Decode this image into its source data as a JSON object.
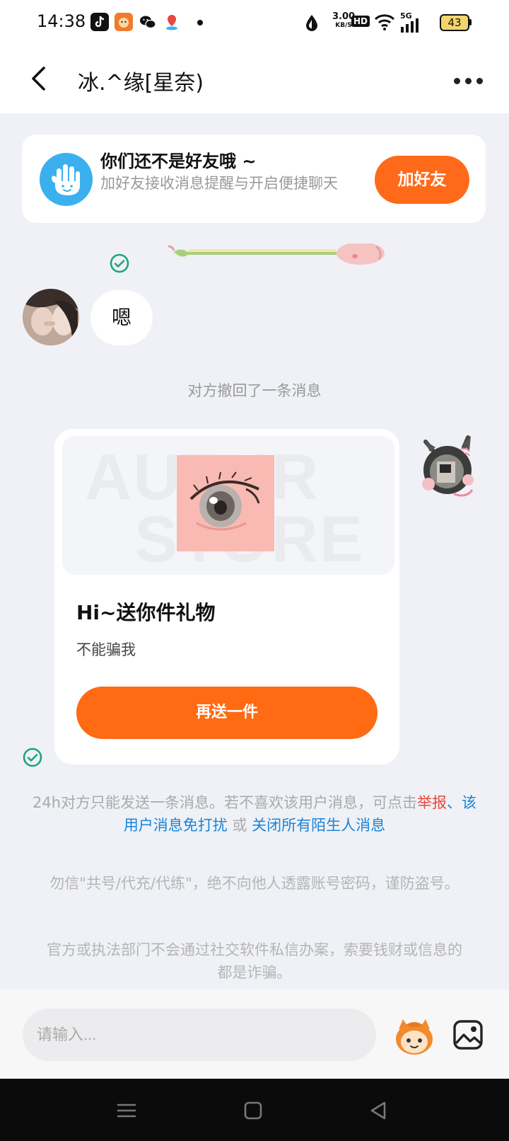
{
  "status_bar": {
    "time": "14:38",
    "net_speed_value": "3.00",
    "net_speed_unit": "KB/S",
    "hd": "HD",
    "signal": "5G",
    "battery": "43",
    "icons": [
      "tiktok-icon",
      "app-icon",
      "wechat-icon",
      "location-app-icon",
      "dot-icon",
      "drop-icon",
      "wifi-icon",
      "signal-icon",
      "battery-icon"
    ]
  },
  "header": {
    "title": "冰.^缘[星奈)"
  },
  "friend_banner": {
    "title": "你们还不是好友哦 ~",
    "subtitle": "加好友接收消息提醒与开启便捷聊天",
    "button": "加好友"
  },
  "messages": {
    "received_text": "嗯",
    "recall_notice": "对方撤回了一条消息"
  },
  "gift_card": {
    "watermark_line1": "AUTHR",
    "watermark_line2": "STORE",
    "title": "Hi~送你件礼物",
    "subtitle": "不能骗我",
    "button": "再送一件"
  },
  "notices": {
    "limit_prefix": "24h对方只能发送一条消息。若不喜欢该用户消息，可点击",
    "report_link": "举报",
    "separator": "、",
    "mute_link": "该用户消息免打扰",
    "or_text": " 或 ",
    "close_link": "关闭所有陌生人消息",
    "security_1": "勿信\"共号/代充/代练\"，绝不向他人透露账号密码，谨防盗号。",
    "security_2": "官方或执法部门不会通过社交软件私信办案，索要钱财或信息的都是诈骗。"
  },
  "input_bar": {
    "placeholder": "请输入..."
  },
  "colors": {
    "accent": "#ff6a12",
    "link_blue": "#1a84d8",
    "link_red": "#e8483f",
    "check_green": "#1aa57a",
    "page_bg": "#eff1f6"
  }
}
